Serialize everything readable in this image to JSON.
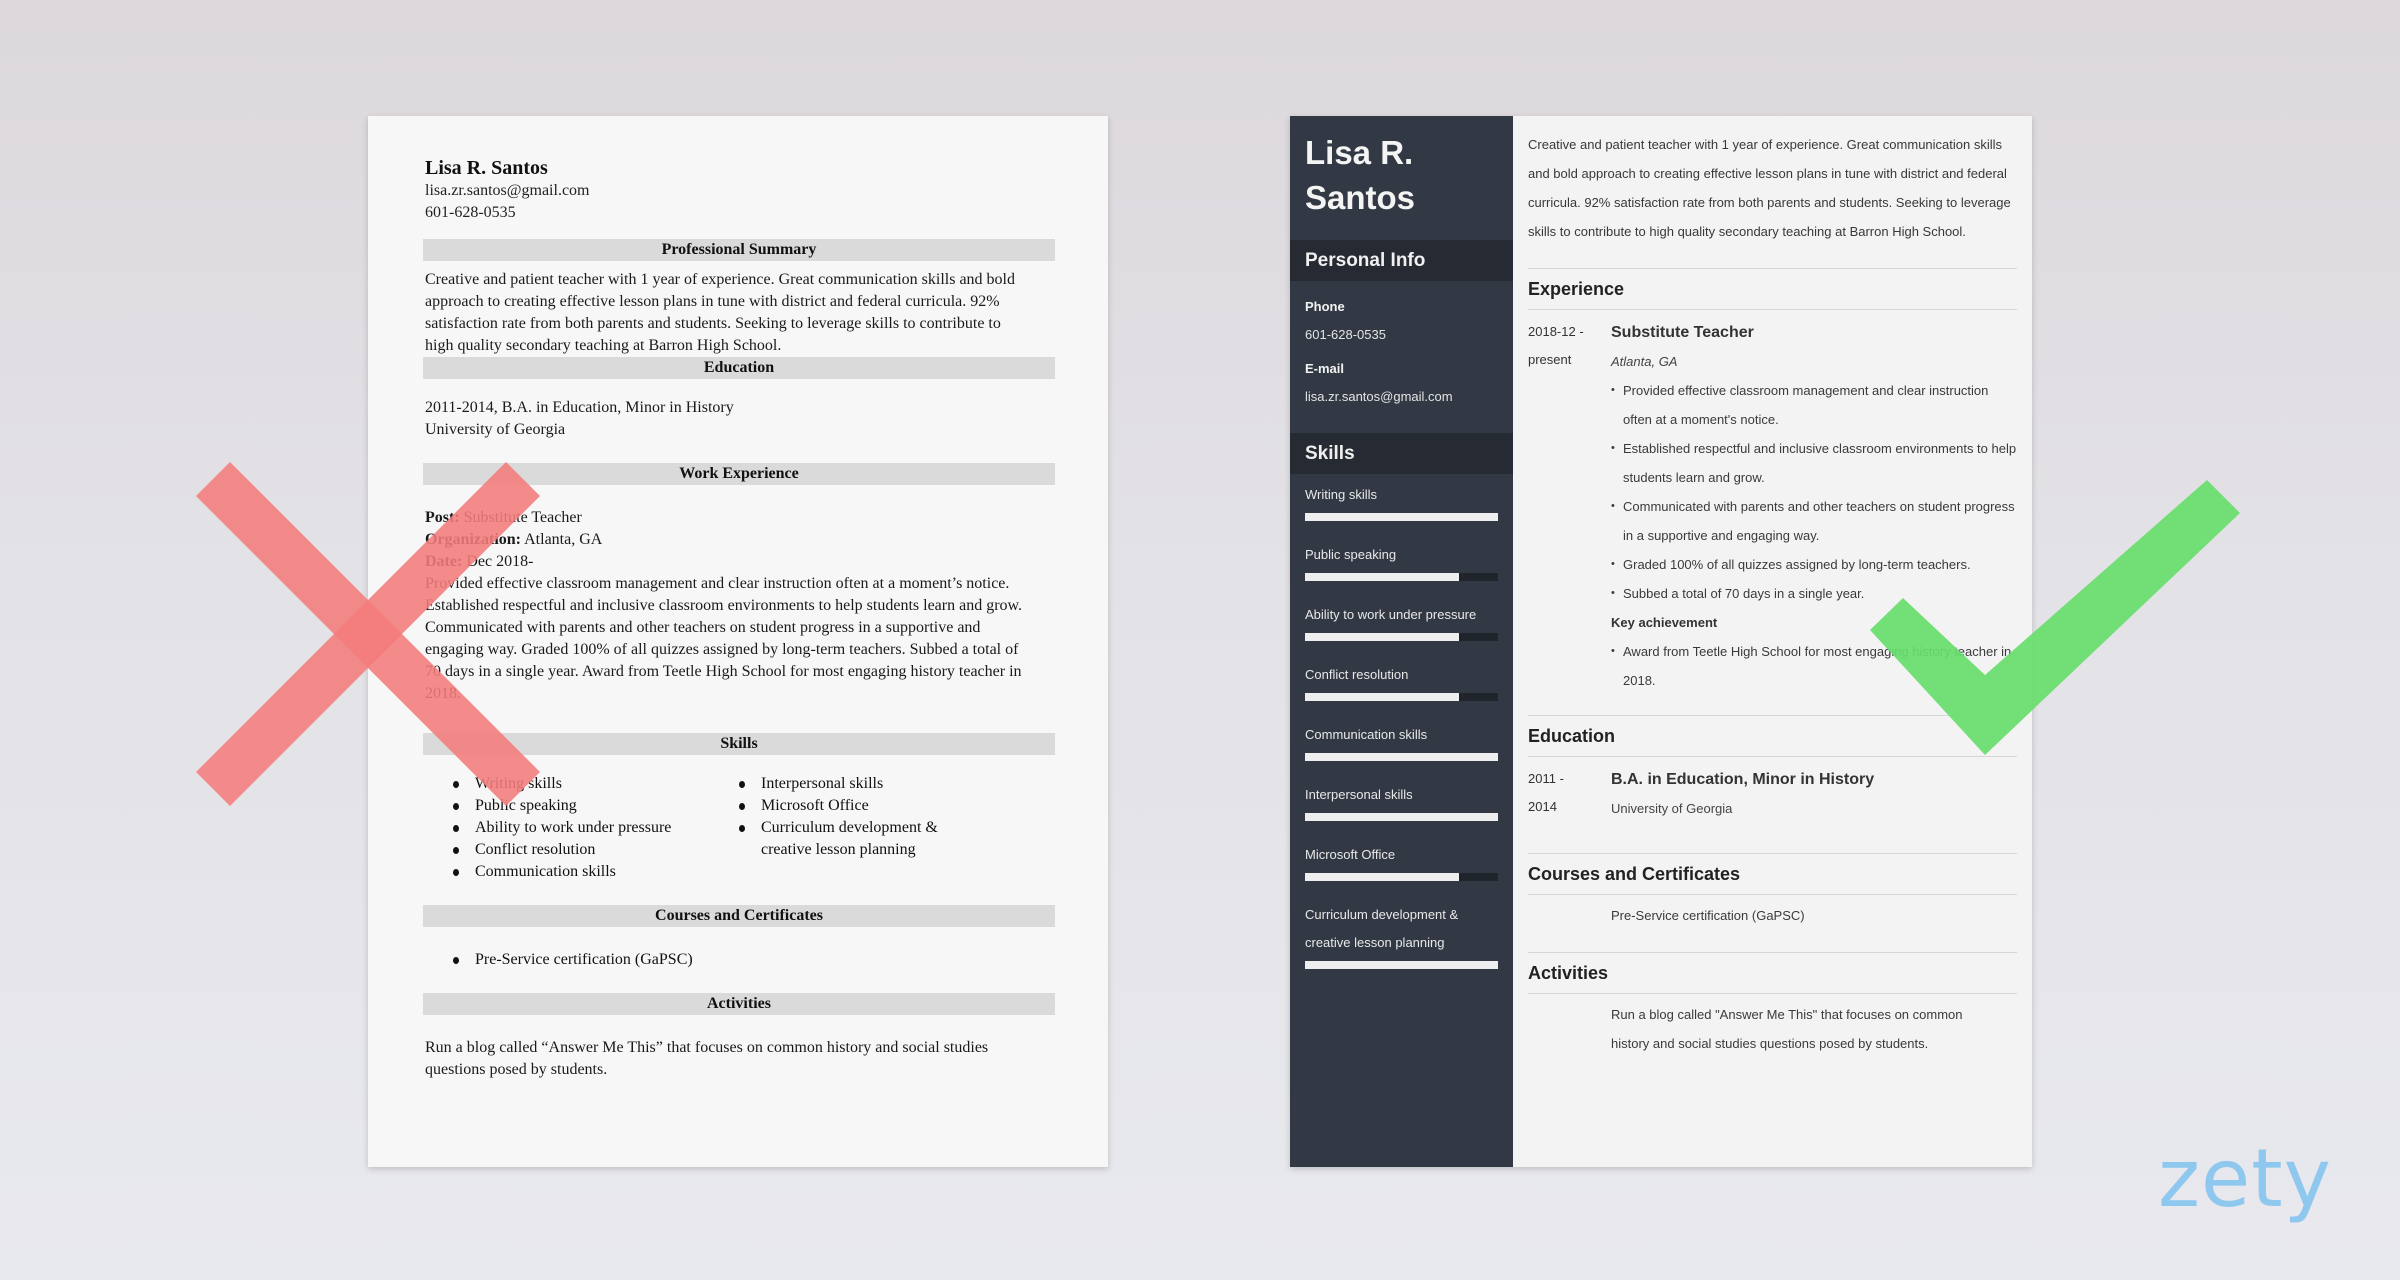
{
  "colors": {
    "sidebar_bg": "#333944",
    "sidebar_header_bg": "#262a32",
    "cross_mark": "#f47c7c",
    "check_mark": "#67dd6c",
    "logo": "#8fc8ee"
  },
  "bad_resume": {
    "name": "Lisa R. Santos",
    "email": "lisa.zr.santos@gmail.com",
    "phone": "601-628-0535",
    "sections": {
      "summary": "Professional Summary",
      "education": "Education",
      "work": "Work Experience",
      "skills": "Skills",
      "courses": "Courses and Certificates",
      "activities": "Activities"
    },
    "summary_lines": [
      "Creative and patient teacher with 1 year of experience. Great communication skills and bold",
      "approach to creating effective lesson plans in tune with district and federal curricula. 92%",
      "satisfaction rate from both parents and students. Seeking to leverage skills to contribute to",
      "high quality secondary teaching at Barron High School."
    ],
    "education": {
      "line1": "2011-2014, B.A. in Education, Minor in History",
      "line2": "University of Georgia"
    },
    "work": {
      "post_label": "Post:",
      "post_value": "Substitute Teacher",
      "org_label": "Organization:",
      "org_value": "Atlanta, GA",
      "date_label": "Date:",
      "date_value": "Dec 2018-",
      "description_lines": [
        "Provided effective classroom management and clear instruction often at a moment’s notice.",
        "Established respectful and inclusive classroom environments to help students learn and grow.",
        "Communicated with parents and other teachers on student progress in a supportive and",
        "engaging way. Graded 100% of all quizzes assigned by long-term teachers. Subbed a total of",
        "70 days in a single year. Award from Teetle High School for most engaging history teacher in",
        "2018."
      ]
    },
    "skills_col1": [
      "Writing skills",
      "Public speaking",
      "Ability to work under pressure",
      "Conflict resolution",
      "Communication skills"
    ],
    "skills_col2": [
      "Interpersonal skills",
      "Microsoft Office",
      "Curriculum development & creative lesson planning"
    ],
    "courses": [
      "Pre-Service certification (GaPSC)"
    ],
    "activities_lines": [
      "Run a blog called “Answer Me This” that focuses on common history and social studies",
      "questions posed by students."
    ]
  },
  "good_resume": {
    "name_line1": "Lisa R.",
    "name_line2": "Santos",
    "personal_info_title": "Personal Info",
    "phone_label": "Phone",
    "phone": "601-628-0535",
    "email_label": "E-mail",
    "email": "lisa.zr.santos@gmail.com",
    "skills_title": "Skills",
    "skills": [
      {
        "name": "Writing skills",
        "level": 1.0
      },
      {
        "name": "Public speaking",
        "level": 0.8
      },
      {
        "name": "Ability to work under pressure",
        "level": 0.8
      },
      {
        "name": "Conflict resolution",
        "level": 0.8
      },
      {
        "name": "Communication skills",
        "level": 1.0
      },
      {
        "name": "Interpersonal skills",
        "level": 1.0
      },
      {
        "name": "Microsoft Office",
        "level": 0.8
      },
      {
        "name": "Curriculum development & creative lesson planning",
        "level": 1.0
      }
    ],
    "summary": "Creative and patient teacher with 1 year of experience. Great communication skills and bold approach to creating effective lesson plans in tune with district and federal curricula. 92% satisfaction rate from both parents and students. Seeking to leverage skills to contribute to high quality secondary teaching at Barron High School.",
    "experience_title": "Experience",
    "experience": {
      "date_start": "2018-12 -",
      "date_end": "present",
      "title": "Substitute Teacher",
      "location": "Atlanta, GA",
      "bullets": [
        "Provided effective classroom management and clear instruction often at a moment's notice.",
        "Established respectful and inclusive classroom environments to help students learn and grow.",
        "Communicated with parents and other teachers on student progress in a supportive and engaging way.",
        "Graded 100% of all quizzes assigned by long-term teachers.",
        "Subbed a total of 70 days in a single year."
      ],
      "key_achievement_label": "Key achievement",
      "key_achievements": [
        "Award from Teetle High School for most engaging history teacher in 2018."
      ]
    },
    "education_title": "Education",
    "education": {
      "date_start": "2011 -",
      "date_end": "2014",
      "degree": "B.A. in Education, Minor in History",
      "school": "University of Georgia"
    },
    "courses_title": "Courses and Certificates",
    "courses": [
      "Pre-Service certification (GaPSC)"
    ],
    "activities_title": "Activities",
    "activities": "Run a blog called \"Answer Me This\" that focuses on common history and social studies questions posed by students."
  },
  "brand": {
    "logo_text": "zety"
  },
  "icons": {
    "bad_marker": "cross-icon",
    "good_marker": "checkmark-icon"
  }
}
